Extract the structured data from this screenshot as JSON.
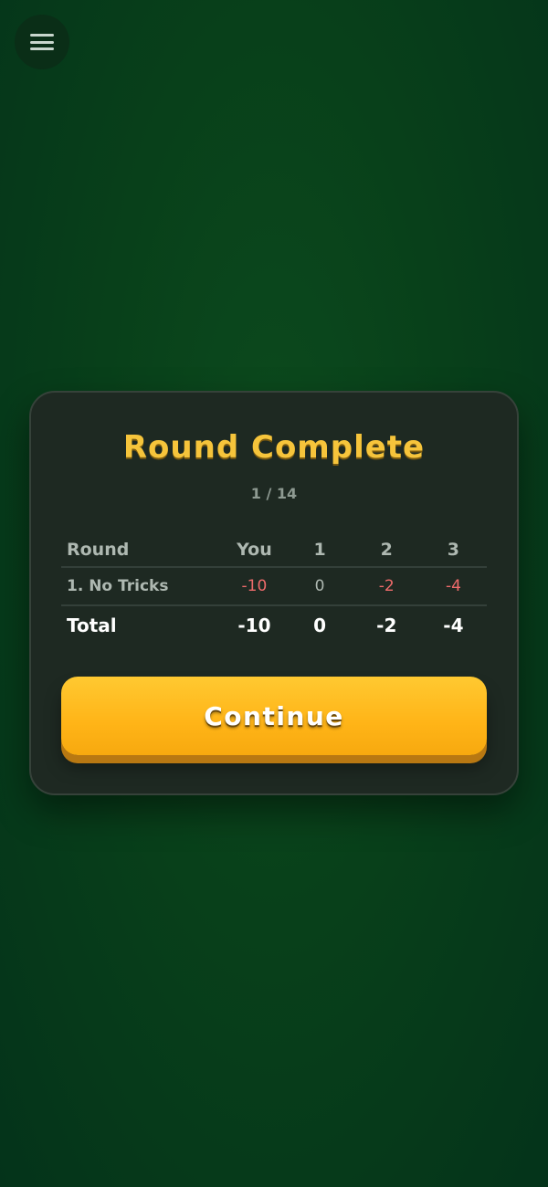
{
  "menu": {
    "icon": "hamburger-menu-icon"
  },
  "dialog": {
    "title": "Round Complete",
    "progress": "1 / 14",
    "table": {
      "headers": [
        "Round",
        "You",
        "1",
        "2",
        "3"
      ],
      "rows": [
        {
          "name": "1. No Tricks",
          "values": [
            "-10",
            "0",
            "-2",
            "-4"
          ]
        }
      ],
      "total": {
        "name": "Total",
        "values": [
          "-10",
          "0",
          "-2",
          "-4"
        ]
      }
    },
    "continue_label": "Continue"
  },
  "colors": {
    "background": "#08401a",
    "title": "#f6c43b",
    "negative": "#ee6b6b",
    "button": "#ffb417"
  }
}
